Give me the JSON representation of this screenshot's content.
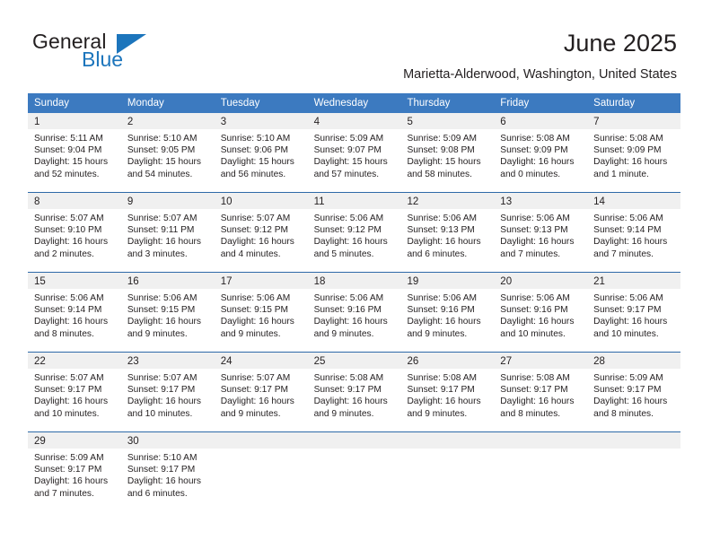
{
  "brand": {
    "name_part1": "General",
    "name_part2": "Blue",
    "accent_color": "#1c75bc"
  },
  "header": {
    "title": "June 2025",
    "subtitle": "Marietta-Alderwood, Washington, United States"
  },
  "theme": {
    "header_blue": "#3c7ac0",
    "rule_blue": "#2e6aa8",
    "date_band_gray": "#f0f0f0"
  },
  "calendar": {
    "weekdays": [
      "Sunday",
      "Monday",
      "Tuesday",
      "Wednesday",
      "Thursday",
      "Friday",
      "Saturday"
    ],
    "weeks": [
      [
        {
          "date": "1",
          "sunrise": "Sunrise: 5:11 AM",
          "sunset": "Sunset: 9:04 PM",
          "daylight1": "Daylight: 15 hours",
          "daylight2": "and 52 minutes."
        },
        {
          "date": "2",
          "sunrise": "Sunrise: 5:10 AM",
          "sunset": "Sunset: 9:05 PM",
          "daylight1": "Daylight: 15 hours",
          "daylight2": "and 54 minutes."
        },
        {
          "date": "3",
          "sunrise": "Sunrise: 5:10 AM",
          "sunset": "Sunset: 9:06 PM",
          "daylight1": "Daylight: 15 hours",
          "daylight2": "and 56 minutes."
        },
        {
          "date": "4",
          "sunrise": "Sunrise: 5:09 AM",
          "sunset": "Sunset: 9:07 PM",
          "daylight1": "Daylight: 15 hours",
          "daylight2": "and 57 minutes."
        },
        {
          "date": "5",
          "sunrise": "Sunrise: 5:09 AM",
          "sunset": "Sunset: 9:08 PM",
          "daylight1": "Daylight: 15 hours",
          "daylight2": "and 58 minutes."
        },
        {
          "date": "6",
          "sunrise": "Sunrise: 5:08 AM",
          "sunset": "Sunset: 9:09 PM",
          "daylight1": "Daylight: 16 hours",
          "daylight2": "and 0 minutes."
        },
        {
          "date": "7",
          "sunrise": "Sunrise: 5:08 AM",
          "sunset": "Sunset: 9:09 PM",
          "daylight1": "Daylight: 16 hours",
          "daylight2": "and 1 minute."
        }
      ],
      [
        {
          "date": "8",
          "sunrise": "Sunrise: 5:07 AM",
          "sunset": "Sunset: 9:10 PM",
          "daylight1": "Daylight: 16 hours",
          "daylight2": "and 2 minutes."
        },
        {
          "date": "9",
          "sunrise": "Sunrise: 5:07 AM",
          "sunset": "Sunset: 9:11 PM",
          "daylight1": "Daylight: 16 hours",
          "daylight2": "and 3 minutes."
        },
        {
          "date": "10",
          "sunrise": "Sunrise: 5:07 AM",
          "sunset": "Sunset: 9:12 PM",
          "daylight1": "Daylight: 16 hours",
          "daylight2": "and 4 minutes."
        },
        {
          "date": "11",
          "sunrise": "Sunrise: 5:06 AM",
          "sunset": "Sunset: 9:12 PM",
          "daylight1": "Daylight: 16 hours",
          "daylight2": "and 5 minutes."
        },
        {
          "date": "12",
          "sunrise": "Sunrise: 5:06 AM",
          "sunset": "Sunset: 9:13 PM",
          "daylight1": "Daylight: 16 hours",
          "daylight2": "and 6 minutes."
        },
        {
          "date": "13",
          "sunrise": "Sunrise: 5:06 AM",
          "sunset": "Sunset: 9:13 PM",
          "daylight1": "Daylight: 16 hours",
          "daylight2": "and 7 minutes."
        },
        {
          "date": "14",
          "sunrise": "Sunrise: 5:06 AM",
          "sunset": "Sunset: 9:14 PM",
          "daylight1": "Daylight: 16 hours",
          "daylight2": "and 7 minutes."
        }
      ],
      [
        {
          "date": "15",
          "sunrise": "Sunrise: 5:06 AM",
          "sunset": "Sunset: 9:14 PM",
          "daylight1": "Daylight: 16 hours",
          "daylight2": "and 8 minutes."
        },
        {
          "date": "16",
          "sunrise": "Sunrise: 5:06 AM",
          "sunset": "Sunset: 9:15 PM",
          "daylight1": "Daylight: 16 hours",
          "daylight2": "and 9 minutes."
        },
        {
          "date": "17",
          "sunrise": "Sunrise: 5:06 AM",
          "sunset": "Sunset: 9:15 PM",
          "daylight1": "Daylight: 16 hours",
          "daylight2": "and 9 minutes."
        },
        {
          "date": "18",
          "sunrise": "Sunrise: 5:06 AM",
          "sunset": "Sunset: 9:16 PM",
          "daylight1": "Daylight: 16 hours",
          "daylight2": "and 9 minutes."
        },
        {
          "date": "19",
          "sunrise": "Sunrise: 5:06 AM",
          "sunset": "Sunset: 9:16 PM",
          "daylight1": "Daylight: 16 hours",
          "daylight2": "and 9 minutes."
        },
        {
          "date": "20",
          "sunrise": "Sunrise: 5:06 AM",
          "sunset": "Sunset: 9:16 PM",
          "daylight1": "Daylight: 16 hours",
          "daylight2": "and 10 minutes."
        },
        {
          "date": "21",
          "sunrise": "Sunrise: 5:06 AM",
          "sunset": "Sunset: 9:17 PM",
          "daylight1": "Daylight: 16 hours",
          "daylight2": "and 10 minutes."
        }
      ],
      [
        {
          "date": "22",
          "sunrise": "Sunrise: 5:07 AM",
          "sunset": "Sunset: 9:17 PM",
          "daylight1": "Daylight: 16 hours",
          "daylight2": "and 10 minutes."
        },
        {
          "date": "23",
          "sunrise": "Sunrise: 5:07 AM",
          "sunset": "Sunset: 9:17 PM",
          "daylight1": "Daylight: 16 hours",
          "daylight2": "and 10 minutes."
        },
        {
          "date": "24",
          "sunrise": "Sunrise: 5:07 AM",
          "sunset": "Sunset: 9:17 PM",
          "daylight1": "Daylight: 16 hours",
          "daylight2": "and 9 minutes."
        },
        {
          "date": "25",
          "sunrise": "Sunrise: 5:08 AM",
          "sunset": "Sunset: 9:17 PM",
          "daylight1": "Daylight: 16 hours",
          "daylight2": "and 9 minutes."
        },
        {
          "date": "26",
          "sunrise": "Sunrise: 5:08 AM",
          "sunset": "Sunset: 9:17 PM",
          "daylight1": "Daylight: 16 hours",
          "daylight2": "and 9 minutes."
        },
        {
          "date": "27",
          "sunrise": "Sunrise: 5:08 AM",
          "sunset": "Sunset: 9:17 PM",
          "daylight1": "Daylight: 16 hours",
          "daylight2": "and 8 minutes."
        },
        {
          "date": "28",
          "sunrise": "Sunrise: 5:09 AM",
          "sunset": "Sunset: 9:17 PM",
          "daylight1": "Daylight: 16 hours",
          "daylight2": "and 8 minutes."
        }
      ],
      [
        {
          "date": "29",
          "sunrise": "Sunrise: 5:09 AM",
          "sunset": "Sunset: 9:17 PM",
          "daylight1": "Daylight: 16 hours",
          "daylight2": "and 7 minutes."
        },
        {
          "date": "30",
          "sunrise": "Sunrise: 5:10 AM",
          "sunset": "Sunset: 9:17 PM",
          "daylight1": "Daylight: 16 hours",
          "daylight2": "and 6 minutes."
        },
        {
          "date": "",
          "sunrise": "",
          "sunset": "",
          "daylight1": "",
          "daylight2": ""
        },
        {
          "date": "",
          "sunrise": "",
          "sunset": "",
          "daylight1": "",
          "daylight2": ""
        },
        {
          "date": "",
          "sunrise": "",
          "sunset": "",
          "daylight1": "",
          "daylight2": ""
        },
        {
          "date": "",
          "sunrise": "",
          "sunset": "",
          "daylight1": "",
          "daylight2": ""
        },
        {
          "date": "",
          "sunrise": "",
          "sunset": "",
          "daylight1": "",
          "daylight2": ""
        }
      ]
    ]
  }
}
